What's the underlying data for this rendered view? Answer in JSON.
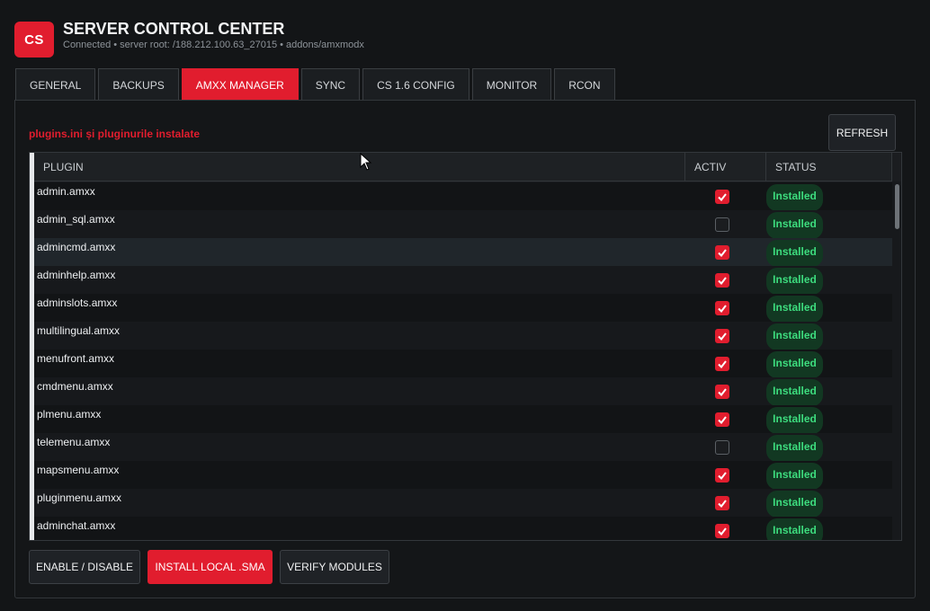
{
  "header": {
    "logo_text": "CS",
    "title": "SERVER CONTROL CENTER",
    "subtitle": "Connected • server root: /188.212.100.63_27015 • addons/amxmodx"
  },
  "tabs": [
    {
      "label": "GENERAL",
      "active": false
    },
    {
      "label": "BACKUPS",
      "active": false
    },
    {
      "label": "AMXX MANAGER",
      "active": true
    },
    {
      "label": "SYNC",
      "active": false
    },
    {
      "label": "CS 1.6 CONFIG",
      "active": false
    },
    {
      "label": "MONITOR",
      "active": false
    },
    {
      "label": "RCON",
      "active": false
    }
  ],
  "panel": {
    "section_title": "plugins.ini și pluginurile instalate",
    "refresh_label": "REFRESH"
  },
  "table": {
    "columns": [
      "PLUGIN",
      "ACTIV",
      "STATUS"
    ],
    "rows": [
      {
        "name": "admin.amxx",
        "active": true,
        "status": "Installed"
      },
      {
        "name": "admin_sql.amxx",
        "active": false,
        "status": "Installed"
      },
      {
        "name": "admincmd.amxx",
        "active": true,
        "status": "Installed"
      },
      {
        "name": "adminhelp.amxx",
        "active": true,
        "status": "Installed"
      },
      {
        "name": "adminslots.amxx",
        "active": true,
        "status": "Installed"
      },
      {
        "name": "multilingual.amxx",
        "active": true,
        "status": "Installed"
      },
      {
        "name": "menufront.amxx",
        "active": true,
        "status": "Installed"
      },
      {
        "name": "cmdmenu.amxx",
        "active": true,
        "status": "Installed"
      },
      {
        "name": "plmenu.amxx",
        "active": true,
        "status": "Installed"
      },
      {
        "name": "telemenu.amxx",
        "active": false,
        "status": "Installed"
      },
      {
        "name": "mapsmenu.amxx",
        "active": true,
        "status": "Installed"
      },
      {
        "name": "pluginmenu.amxx",
        "active": true,
        "status": "Installed"
      },
      {
        "name": "adminchat.amxx",
        "active": true,
        "status": "Installed"
      }
    ]
  },
  "footer": {
    "enable_disable_label": "ENABLE / DISABLE",
    "install_label": "INSTALL LOCAL .SMA",
    "verify_label": "VERIFY MODULES"
  },
  "colors": {
    "accent": "#e11d2e",
    "status_green": "#3ddc7e",
    "background": "#131517"
  }
}
